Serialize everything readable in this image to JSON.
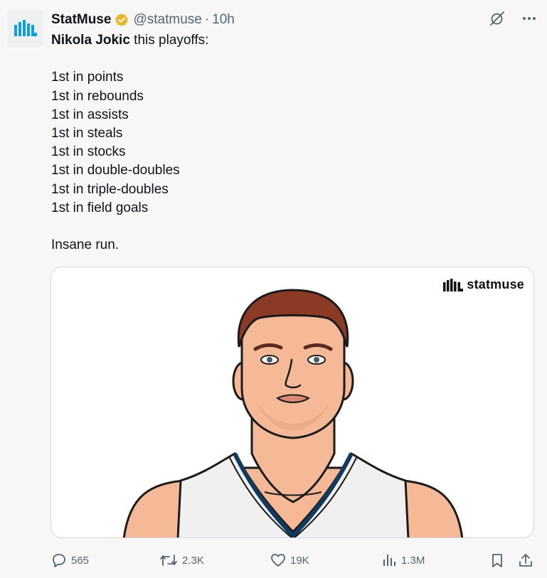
{
  "tweet": {
    "author_name": "StatMuse",
    "handle": "@statmuse",
    "separator": "·",
    "time": "10h",
    "text": {
      "player": "Nikola Jokic",
      "intro_rest": " this playoffs:",
      "lines": [
        "1st in points",
        "1st in rebounds",
        "1st in assists",
        "1st in steals",
        "1st in stocks",
        "1st in double-doubles",
        "1st in triple-doubles",
        "1st in field goals"
      ],
      "closing": "Insane run."
    },
    "media": {
      "watermark": "statmuse"
    },
    "actions": {
      "replies": "565",
      "reposts": "2.3K",
      "likes": "19K",
      "views": "1.3M"
    }
  },
  "icons": {
    "verified": "verified-badge-icon",
    "grok": "grok-icon",
    "more": "more-icon",
    "reply": "reply-icon",
    "repost": "repost-icon",
    "like": "like-icon",
    "views": "views-icon",
    "bookmark": "bookmark-icon",
    "share": "share-icon"
  },
  "colors": {
    "verified": "#e8b829",
    "brand": "#0e9fd8",
    "secondary_text": "#536471",
    "skin": "#f6b997",
    "hair": "#8b3a26"
  }
}
